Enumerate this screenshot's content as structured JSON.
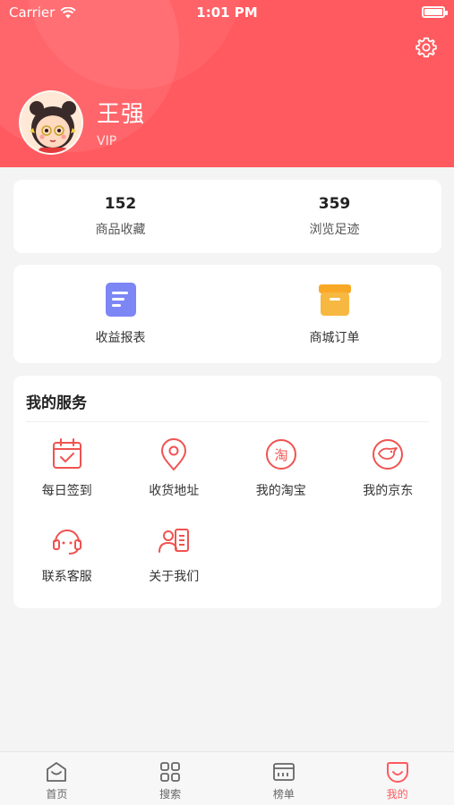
{
  "status_bar": {
    "carrier": "Carrier",
    "time": "1:01 PM"
  },
  "profile": {
    "name": "王强",
    "level": "VIP"
  },
  "stats": [
    {
      "value": "152",
      "label": "商品收藏"
    },
    {
      "value": "359",
      "label": "浏览足迹"
    }
  ],
  "quick_actions": [
    {
      "label": "收益报表",
      "icon": "report-icon"
    },
    {
      "label": "商城订单",
      "icon": "order-box-icon"
    }
  ],
  "services": {
    "title": "我的服务",
    "items": [
      {
        "label": "每日签到",
        "icon": "calendar-check-icon"
      },
      {
        "label": "收货地址",
        "icon": "location-pin-icon"
      },
      {
        "label": "我的淘宝",
        "icon": "taobao-icon"
      },
      {
        "label": "我的京东",
        "icon": "jd-icon"
      },
      {
        "label": "联系客服",
        "icon": "headset-icon"
      },
      {
        "label": "关于我们",
        "icon": "contact-card-icon"
      }
    ]
  },
  "tabs": [
    {
      "label": "首页",
      "icon": "home-icon"
    },
    {
      "label": "搜索",
      "icon": "grid-icon"
    },
    {
      "label": "榜单",
      "icon": "ranking-icon"
    },
    {
      "label": "我的",
      "icon": "smile-icon",
      "active": true
    }
  ],
  "colors": {
    "accent": "#ff5a5f",
    "report_icon": "#7d86f5",
    "order_icon": "#f9a826"
  },
  "icons": {
    "taobao_glyph": "淘"
  }
}
